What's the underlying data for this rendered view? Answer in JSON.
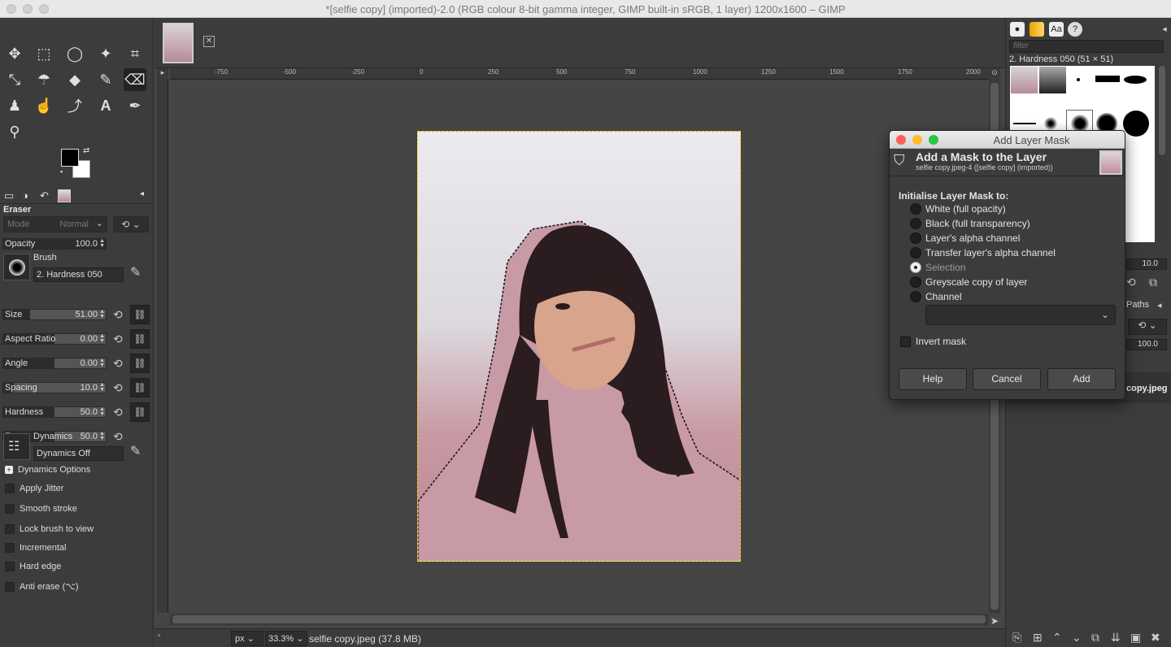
{
  "window": {
    "title": "*[selfie copy] (imported)-2.0 (RGB colour 8-bit gamma integer, GIMP built-in sRGB, 1 layer) 1200x1600 – GIMP"
  },
  "toolbox": {
    "tool_options_title": "Eraser",
    "mode_label": "Mode",
    "mode_value": "Normal",
    "opacity": {
      "label": "Opacity",
      "value": "100.0",
      "fraction": 1.0
    },
    "brush": {
      "label": "Brush",
      "name": "2. Hardness 050"
    },
    "sliders": [
      {
        "label": "Size",
        "value": "51.00",
        "fraction": 0.26
      },
      {
        "label": "Aspect Ratio",
        "value": "0.00",
        "fraction": 0.5
      },
      {
        "label": "Angle",
        "value": "0.00",
        "fraction": 0.5
      },
      {
        "label": "Spacing",
        "value": "10.0",
        "fraction": 0.1
      },
      {
        "label": "Hardness",
        "value": "50.0",
        "fraction": 0.5
      },
      {
        "label": "Force",
        "value": "50.0",
        "fraction": 0.5
      }
    ],
    "dynamics": {
      "label": "Dynamics",
      "name": "Dynamics Off"
    },
    "dynamics_options_label": "Dynamics Options",
    "checkboxes": [
      "Apply Jitter",
      "Smooth stroke",
      "Lock brush to view",
      "Incremental",
      "Hard edge",
      "Anti erase  (⌥)"
    ]
  },
  "image_window": {
    "ruler_ticks": [
      "-750",
      "-500",
      "-250",
      "0",
      "250",
      "500",
      "750",
      "1000",
      "1250",
      "1500",
      "1750",
      "2000"
    ],
    "statusbar": {
      "unit": "px",
      "zoom": "33.3%",
      "file_info": "selfie copy.jpeg (37.8 MB)"
    }
  },
  "dock": {
    "filter_placeholder": "filter",
    "brush_name": "2. Hardness 050 (51 × 51)",
    "spacing_value": "10.0",
    "paths_tab": "Paths",
    "opacity_value": "100.0",
    "layer_name": "copy.jpeg"
  },
  "dialog": {
    "title": "Add Layer Mask",
    "heading": "Add a Mask to the Layer",
    "subheading": "selfie copy.jpeg-4 ([selfie copy] (imported))",
    "init_label": "Initialise Layer Mask to:",
    "options": [
      "White (full opacity)",
      "Black (full transparency)",
      "Layer's alpha channel",
      "Transfer layer's alpha channel",
      "Selection",
      "Greyscale copy of layer",
      "Channel"
    ],
    "selected_option": "Selection",
    "invert_label": "Invert mask",
    "buttons": {
      "help": "Help",
      "cancel": "Cancel",
      "add": "Add"
    }
  },
  "colors": {
    "accent": "#ffd700",
    "close_light": "#fe5f57",
    "min_light": "#febc2e",
    "max_light": "#28c840"
  }
}
